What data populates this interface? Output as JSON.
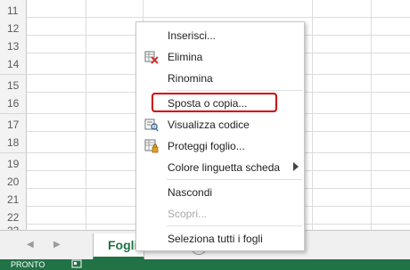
{
  "sheet": {
    "row_numbers": [
      "11",
      "12",
      "13",
      "14",
      "15",
      "16",
      "17",
      "18",
      "19",
      "20",
      "21",
      "22",
      "23"
    ]
  },
  "tabs": {
    "prev_arrow": "◀",
    "next_arrow": "▶",
    "active_tab_label": "Fogli",
    "add_sheet_symbol": "+"
  },
  "status": {
    "text": "PRONTO",
    "bar_color": "#217346"
  },
  "context_menu": {
    "items": [
      {
        "label": "Inserisci...",
        "icon": null,
        "enabled": true
      },
      {
        "label": "Elimina",
        "icon": "delete-sheet-icon",
        "enabled": true
      },
      {
        "label": "Rinomina",
        "icon": null,
        "enabled": true
      },
      {
        "label": "Sposta o copia...",
        "icon": null,
        "enabled": true,
        "highlighted": true
      },
      {
        "label": "Visualizza codice",
        "icon": "view-code-icon",
        "enabled": true
      },
      {
        "label": "Proteggi foglio...",
        "icon": "protect-sheet-icon",
        "enabled": true
      },
      {
        "label": "Colore linguetta scheda",
        "icon": null,
        "enabled": true,
        "has_submenu": true
      },
      {
        "label": "Nascondi",
        "icon": null,
        "enabled": true
      },
      {
        "label": "Scopri...",
        "icon": null,
        "enabled": false
      },
      {
        "label": "Seleziona tutti i fogli",
        "icon": null,
        "enabled": true
      }
    ],
    "highlight_color": "#d00000"
  }
}
